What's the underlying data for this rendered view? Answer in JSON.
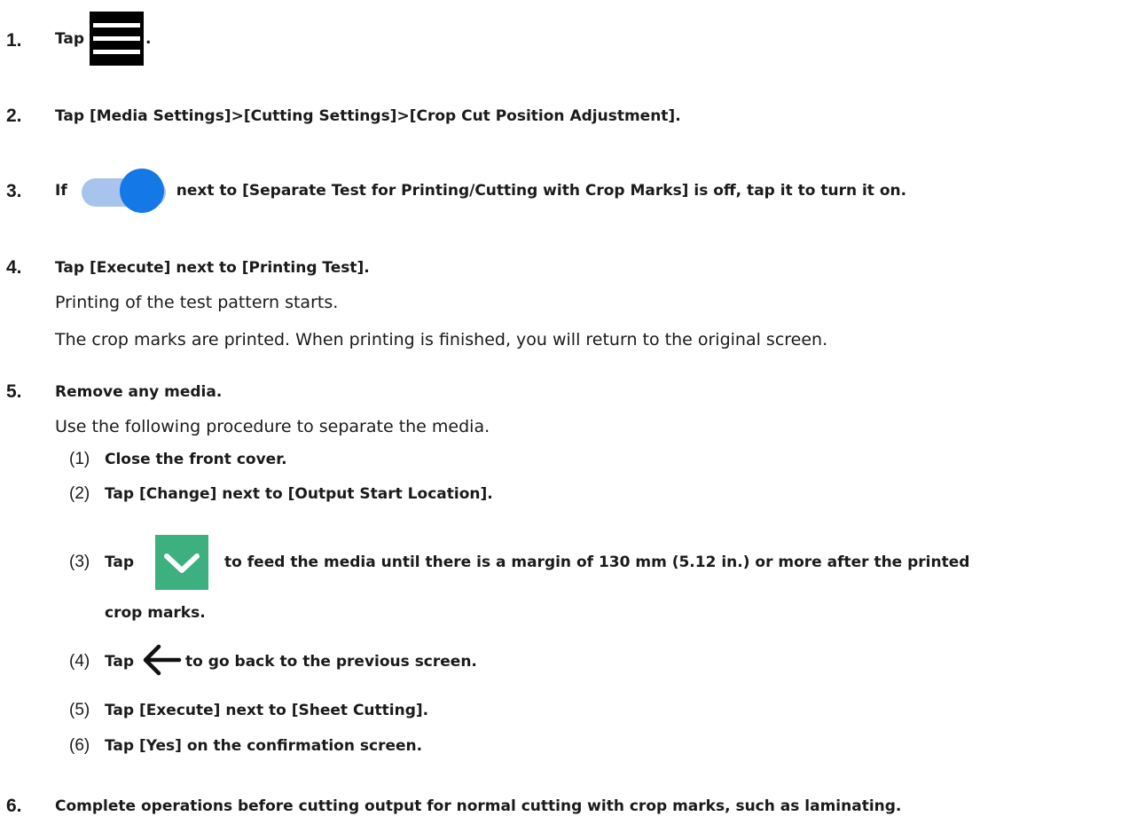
{
  "steps": [
    {
      "number": "1.",
      "pre": "Tap",
      "post": "."
    },
    {
      "number": "2.",
      "text": "Tap [Media Settings]>[Cutting Settings]>[Crop Cut Position Adjustment]."
    },
    {
      "number": "3.",
      "pre": "If",
      "post": "next to [Separate Test for Printing/Cutting with Crop Marks] is off, tap it to turn it on."
    },
    {
      "number": "4.",
      "text": "Tap [Execute] next to [Printing Test].",
      "results": [
        "Printing of the test pattern starts.",
        "The crop marks are printed. When printing is finished, you will return to the original screen."
      ]
    },
    {
      "number": "5.",
      "text": "Remove any media.",
      "intro": "Use the following procedure to separate the media.",
      "substeps": [
        {
          "number": "(1)",
          "text": "Close the front cover."
        },
        {
          "number": "(2)",
          "text": "Tap [Change] next to [Output Start Location]."
        },
        {
          "number": "(3)",
          "pre": "Tap",
          "post": "to feed the media until there is a margin of 130 mm (5.12 in.) or more after the printed",
          "cont": "crop marks."
        },
        {
          "number": "(4)",
          "pre": "Tap",
          "post": "to go back to the previous screen."
        },
        {
          "number": "(5)",
          "text": "Tap [Execute] next to [Sheet Cutting]."
        },
        {
          "number": "(6)",
          "text": "Tap [Yes] on the confirmation screen."
        }
      ]
    },
    {
      "number": "6.",
      "text": "Complete operations before cutting output for normal cutting with crop marks, such as laminating."
    }
  ],
  "icons": {
    "menu": "menu-icon",
    "toggle": "toggle-switch-icon",
    "feed": "chevron-down-icon",
    "back": "arrow-left-icon"
  },
  "colors": {
    "toggle_track": "#a8c3ec",
    "toggle_knob": "#1479e6",
    "feed_button": "#3cb07e",
    "menu_icon": "#000000"
  }
}
